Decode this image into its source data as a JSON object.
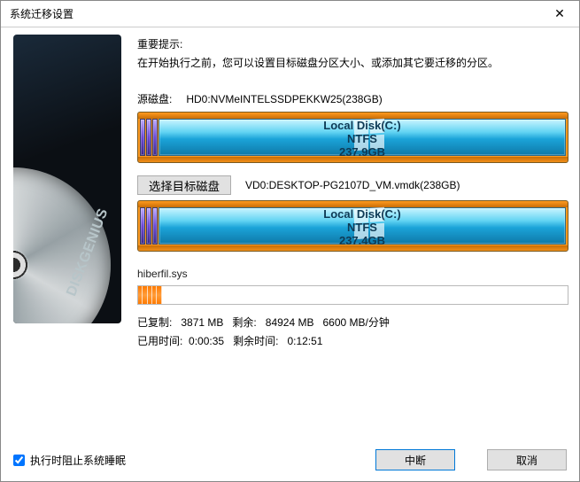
{
  "window": {
    "title": "系统迁移设置"
  },
  "hint": {
    "title": "重要提示:",
    "text": "在开始执行之前，您可以设置目标磁盘分区大小、或添加其它要迁移的分区。"
  },
  "brand": "DISKGENIUS",
  "source": {
    "label": "源磁盘:",
    "name": "HD0:NVMeINTELSSDPEKKW25(238GB)",
    "partition": {
      "name": "Local Disk(C:)",
      "fs": "NTFS",
      "size": "237.9GB"
    }
  },
  "target": {
    "select_btn": "选择目标磁盘",
    "name": "VD0:DESKTOP-PG2107D_VM.vmdk(238GB)",
    "partition": {
      "name": "Local Disk(C:)",
      "fs": "NTFS",
      "size": "237.4GB"
    }
  },
  "progress": {
    "file": "hiberfil.sys",
    "line1_copied_label": "已复制:",
    "line1_copied": "3871 MB",
    "line1_remain_label": "剩余:",
    "line1_remain": "84924 MB",
    "line1_rate": "6600 MB/分钟",
    "line2_used_label": "已用时间:",
    "line2_used": "0:00:35",
    "line2_left_label": "剩余时间:",
    "line2_left": "0:12:51"
  },
  "footer": {
    "checkbox": "执行时阻止系统睡眠",
    "abort": "中断",
    "cancel": "取消"
  }
}
